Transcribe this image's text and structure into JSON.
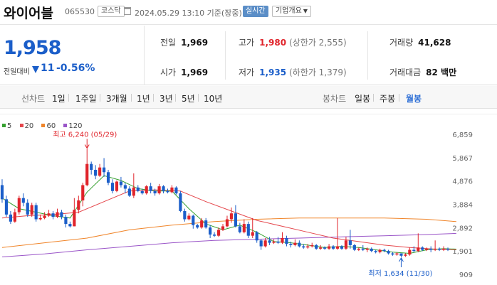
{
  "header": {
    "stock_name": "와이어블",
    "stock_code": "065530",
    "market_badge": "코스닥",
    "timestamp": "2024.05.29 13:10 기준(장중)",
    "live_label": "실시간",
    "info_label": "기업개요"
  },
  "quote": {
    "price": "1,958",
    "change_label": "전일대비",
    "change_value": "11",
    "change_pct": "-0.56%",
    "prev_close_label": "전일",
    "prev_close": "1,969",
    "open_label": "시가",
    "open": "1,969",
    "high_label": "고가",
    "high": "1,980",
    "upper_limit": "(상한가 2,555)",
    "low_label": "저가",
    "low": "1,935",
    "lower_limit": "(하한가 1,379)",
    "volume_label": "거래량",
    "volume": "41,628",
    "amount_label": "거래대금",
    "amount": "82 백만"
  },
  "period_bar": {
    "line_label": "선차트",
    "line_options": [
      "1일",
      "1주일",
      "3개월",
      "1년",
      "3년",
      "5년",
      "10년"
    ],
    "candle_label": "봉차트",
    "candle_options": [
      "일봉",
      "주봉",
      "월봉"
    ],
    "active_candle": "월봉"
  },
  "colors": {
    "up": "#e0242b",
    "down": "#1b5ec9",
    "ma5": "#35a02f",
    "ma20": "#e5474c",
    "ma60": "#f0852a",
    "ma120": "#9a55c8"
  },
  "chart_data": {
    "type": "candlestick",
    "interval": "월봉",
    "y_ticks": [
      6859,
      5867,
      4876,
      3884,
      2892,
      1901,
      909
    ],
    "y_tick_labels": [
      "6,859",
      "5,867",
      "4,876",
      "3,884",
      "2,892",
      "1,901",
      "909"
    ],
    "ylim": [
      909,
      6859
    ],
    "legend": [
      {
        "name": "5",
        "color": "#35a02f"
      },
      {
        "name": "20",
        "color": "#e5474c"
      },
      {
        "name": "60",
        "color": "#f0852a"
      },
      {
        "name": "120",
        "color": "#9a55c8"
      }
    ],
    "annotations": {
      "high": {
        "label": "최고 6,240 (05/29)",
        "value": 6240,
        "index": 20
      },
      "low": {
        "label": "최저 1,634 (11/30)",
        "value": 1634,
        "index": 94
      }
    },
    "candles": [
      [
        4700,
        4100,
        4950,
        3950
      ],
      [
        4100,
        3450,
        4250,
        3350
      ],
      [
        3450,
        3150,
        3600,
        3050
      ],
      [
        3150,
        3550,
        3700,
        3100
      ],
      [
        3550,
        4150,
        4250,
        3450
      ],
      [
        4150,
        3950,
        4350,
        3800
      ],
      [
        3950,
        3450,
        4100,
        3350
      ],
      [
        3450,
        3850,
        3950,
        3350
      ],
      [
        3850,
        3250,
        3950,
        3150
      ],
      [
        3250,
        3300,
        3450,
        3200
      ],
      [
        3300,
        3400,
        3550,
        3250
      ],
      [
        3400,
        3500,
        3650,
        3350
      ],
      [
        3500,
        3350,
        3600,
        3250
      ],
      [
        3350,
        3550,
        3700,
        3300
      ],
      [
        3550,
        3350,
        3650,
        3250
      ],
      [
        3350,
        3050,
        3450,
        2900
      ],
      [
        3050,
        2950,
        3150,
        2900
      ],
      [
        2950,
        3650,
        4150,
        2950
      ],
      [
        3650,
        4050,
        4250,
        3500
      ],
      [
        4050,
        4700,
        4800,
        3800
      ],
      [
        4700,
        5600,
        6240,
        4650
      ],
      [
        5600,
        5350,
        5700,
        5150
      ],
      [
        5350,
        5100,
        5550,
        4950
      ],
      [
        5100,
        5450,
        5600,
        5050
      ],
      [
        5450,
        5250,
        5850,
        5050
      ],
      [
        5250,
        4800,
        5350,
        4700
      ],
      [
        4800,
        4450,
        4950,
        4350
      ],
      [
        4450,
        4850,
        4900,
        4400
      ],
      [
        4850,
        4700,
        5050,
        4600
      ],
      [
        4700,
        4550,
        4800,
        4350
      ],
      [
        4550,
        4250,
        4650,
        4200
      ],
      [
        4250,
        4600,
        5200,
        4150
      ],
      [
        4600,
        4450,
        4700,
        4400
      ],
      [
        4450,
        4350,
        4550,
        4300
      ],
      [
        4350,
        4650,
        4700,
        4300
      ],
      [
        4650,
        4450,
        4800,
        4350
      ],
      [
        4450,
        4350,
        4550,
        4250
      ],
      [
        4350,
        4650,
        4750,
        4300
      ],
      [
        4650,
        4450,
        4700,
        4350
      ],
      [
        4450,
        4400,
        4550,
        4350
      ],
      [
        4400,
        4600,
        4700,
        4350
      ],
      [
        4600,
        4350,
        4650,
        4300
      ],
      [
        4350,
        3600,
        4450,
        3550
      ],
      [
        3600,
        3250,
        3700,
        3150
      ],
      [
        3250,
        3400,
        3500,
        3200
      ],
      [
        3400,
        3000,
        3450,
        2850
      ],
      [
        3000,
        2900,
        3050,
        2850
      ],
      [
        2900,
        3200,
        3300,
        2850
      ],
      [
        3200,
        2900,
        3300,
        2850
      ],
      [
        2900,
        2600,
        3000,
        2450
      ],
      [
        2600,
        2550,
        2700,
        2500
      ],
      [
        2550,
        2800,
        2900,
        2500
      ],
      [
        2800,
        2950,
        3050,
        2750
      ],
      [
        2950,
        3250,
        3400,
        2900
      ],
      [
        3250,
        3500,
        3750,
        3100
      ],
      [
        3500,
        2950,
        3850,
        2900
      ],
      [
        2950,
        2700,
        3100,
        2650
      ],
      [
        2700,
        3050,
        3250,
        2650
      ],
      [
        3050,
        2550,
        3150,
        2450
      ],
      [
        2550,
        2700,
        3300,
        2450
      ],
      [
        2700,
        2350,
        2750,
        2250
      ],
      [
        2350,
        2100,
        2400,
        1950
      ],
      [
        2100,
        2350,
        2450,
        2050
      ],
      [
        2350,
        2250,
        2500,
        2150
      ],
      [
        2250,
        2300,
        2400,
        2200
      ],
      [
        2300,
        2250,
        2500,
        2200
      ],
      [
        2250,
        2450,
        2700,
        2200
      ],
      [
        2450,
        2200,
        2550,
        2100
      ],
      [
        2200,
        2150,
        2300,
        2050
      ],
      [
        2150,
        2250,
        2400,
        2100
      ],
      [
        2250,
        2100,
        2350,
        2050
      ],
      [
        2100,
        2050,
        2200,
        2000
      ],
      [
        2050,
        2100,
        2200,
        2000
      ],
      [
        2100,
        2150,
        2250,
        2050
      ],
      [
        2150,
        2000,
        2200,
        1950
      ],
      [
        2000,
        2050,
        2150,
        1950
      ],
      [
        2050,
        2000,
        2100,
        1950
      ],
      [
        2000,
        2100,
        2200,
        1950
      ],
      [
        2100,
        2000,
        2150,
        1950
      ],
      [
        2000,
        2100,
        3300,
        1950
      ],
      [
        2100,
        2000,
        2150,
        1950
      ],
      [
        2000,
        2350,
        2500,
        1950
      ],
      [
        2350,
        2150,
        2800,
        2000
      ],
      [
        2150,
        1950,
        2200,
        1900
      ],
      [
        1950,
        2000,
        2050,
        1900
      ],
      [
        2000,
        1950,
        2150,
        1900
      ],
      [
        1950,
        2000,
        2050,
        1850
      ],
      [
        2000,
        1900,
        2050,
        1850
      ],
      [
        1900,
        1850,
        1950,
        1800
      ],
      [
        1850,
        1950,
        2000,
        1800
      ],
      [
        1950,
        1900,
        2000,
        1850
      ],
      [
        1900,
        1800,
        1950,
        1750
      ],
      [
        1800,
        1750,
        1850,
        1700
      ],
      [
        1750,
        1800,
        1850,
        1700
      ],
      [
        1800,
        1700,
        1800,
        1634
      ],
      [
        1700,
        1750,
        1800,
        1650
      ],
      [
        1750,
        1950,
        2050,
        1700
      ],
      [
        1950,
        1900,
        2100,
        1850
      ],
      [
        1900,
        2050,
        2650,
        1850
      ],
      [
        2050,
        1950,
        2100,
        1900
      ],
      [
        1950,
        2000,
        2050,
        1900
      ],
      [
        2000,
        1950,
        2100,
        1850
      ],
      [
        1950,
        2000,
        2350,
        1900
      ],
      [
        2000,
        1950,
        2050,
        1900
      ],
      [
        1950,
        2000,
        2100,
        1900
      ],
      [
        2000,
        1958,
        2050,
        1900
      ]
    ],
    "series": [
      {
        "name": "5",
        "values": [
          [
            0,
            4150
          ],
          [
            4,
            3700
          ],
          [
            8,
            3550
          ],
          [
            12,
            3400
          ],
          [
            16,
            3300
          ],
          [
            20,
            4400
          ],
          [
            24,
            5100
          ],
          [
            28,
            4900
          ],
          [
            32,
            4550
          ],
          [
            36,
            4450
          ],
          [
            40,
            4450
          ],
          [
            44,
            3700
          ],
          [
            48,
            3050
          ],
          [
            52,
            2800
          ],
          [
            56,
            3000
          ],
          [
            60,
            2700
          ],
          [
            64,
            2300
          ],
          [
            68,
            2250
          ],
          [
            72,
            2150
          ],
          [
            76,
            2050
          ],
          [
            80,
            2100
          ],
          [
            84,
            2050
          ],
          [
            88,
            1950
          ],
          [
            92,
            1850
          ],
          [
            96,
            1800
          ],
          [
            100,
            1950
          ],
          [
            104,
            2000
          ],
          [
            107,
            1980
          ]
        ]
      },
      {
        "name": "20",
        "values": [
          [
            0,
            3300
          ],
          [
            6,
            3400
          ],
          [
            12,
            3450
          ],
          [
            18,
            3550
          ],
          [
            24,
            4000
          ],
          [
            30,
            4450
          ],
          [
            36,
            4500
          ],
          [
            42,
            4450
          ],
          [
            48,
            4000
          ],
          [
            54,
            3600
          ],
          [
            60,
            3200
          ],
          [
            66,
            2950
          ],
          [
            72,
            2700
          ],
          [
            78,
            2450
          ],
          [
            84,
            2300
          ],
          [
            90,
            2150
          ],
          [
            96,
            2050
          ],
          [
            102,
            1980
          ],
          [
            107,
            1950
          ]
        ]
      },
      {
        "name": "60",
        "values": [
          [
            0,
            2050
          ],
          [
            10,
            2250
          ],
          [
            20,
            2450
          ],
          [
            30,
            2800
          ],
          [
            40,
            3000
          ],
          [
            50,
            3150
          ],
          [
            60,
            3250
          ],
          [
            70,
            3300
          ],
          [
            80,
            3300
          ],
          [
            90,
            3300
          ],
          [
            100,
            3250
          ],
          [
            107,
            3150
          ]
        ]
      },
      {
        "name": "120",
        "values": [
          [
            0,
            1650
          ],
          [
            10,
            1780
          ],
          [
            20,
            1950
          ],
          [
            30,
            2100
          ],
          [
            40,
            2250
          ],
          [
            50,
            2350
          ],
          [
            60,
            2400
          ],
          [
            70,
            2450
          ],
          [
            80,
            2500
          ],
          [
            90,
            2550
          ],
          [
            100,
            2600
          ],
          [
            107,
            2650
          ]
        ]
      }
    ]
  }
}
